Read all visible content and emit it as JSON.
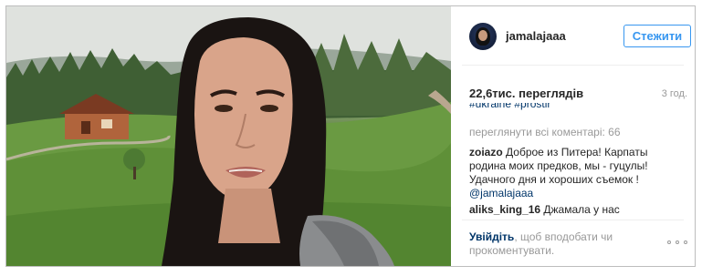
{
  "post": {
    "username": "jamalajaaa",
    "follow_label": "Стежити",
    "views": "22,6тис. переглядів",
    "time_ago": "3 год.",
    "hashtag_cut": "#ukraine #prostir",
    "view_all_comments": "переглянути всі коментарі: 66"
  },
  "comments": [
    {
      "author": "zoiazo",
      "text": "Доброе из Питера! Карпаты родина моих предков, мы - гуцулы! Удачного дня и хороших съемок !",
      "mention": "@jamalajaaa"
    },
    {
      "author": "aliks_king_16",
      "text": "Джамала у нас"
    }
  ],
  "footer": {
    "login_link": "Увійдіть",
    "login_text": ", щоб вподобати чи прокоментувати."
  },
  "icons": {
    "more": "more-options-icon",
    "avatar": "profile-avatar"
  },
  "colors": {
    "accent": "#3897f0",
    "link": "#003569",
    "muted": "#999999"
  }
}
